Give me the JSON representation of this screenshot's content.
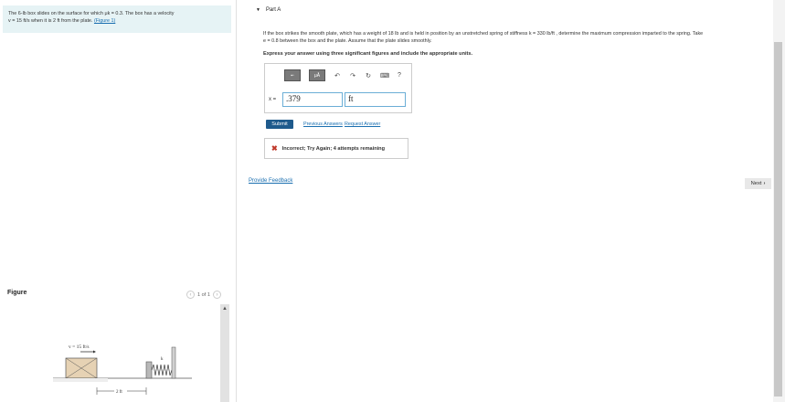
{
  "problem": {
    "line1": "The 6-lb box slides on the surface for which μk = 0.3. The box has a velocity",
    "line2": "v = 15 ft/s when it is 2 ft from the plate.",
    "figure_link": "(Figure 1)"
  },
  "figure": {
    "title": "Figure",
    "page": "1 of 1",
    "velocity_label": "v = 15 ft/s",
    "k_label": "k",
    "distance_label": "2 ft"
  },
  "part": {
    "label": "Part A"
  },
  "question": {
    "line1": "If the box strikes the smooth plate, which has a weight of 18 lb and is held in position by an unstretched spring of stiffness k = 330 lb/ft , determine the maximum compression imparted to the spring. Take",
    "line2": "e = 0.8 between the box and the plate. Assume that the plate slides smoothly."
  },
  "instruction": "Express your answer using three significant figures and include the appropriate units.",
  "answer": {
    "variable": "x =",
    "value": ".379",
    "units": "ft"
  },
  "toolbar": {
    "help": "?"
  },
  "buttons": {
    "submit": "Submit",
    "previous_answers": "Previous Answers",
    "request_answer": "Request Answer",
    "next": "Next"
  },
  "feedback": {
    "text": "Incorrect; Try Again; 4 attempts remaining"
  },
  "provide_feedback": "Provide Feedback",
  "colors": {
    "accent": "#1e5a8c",
    "link": "#1a6fb0",
    "error": "#c0392b",
    "problem_bg": "#e6f3f5"
  }
}
